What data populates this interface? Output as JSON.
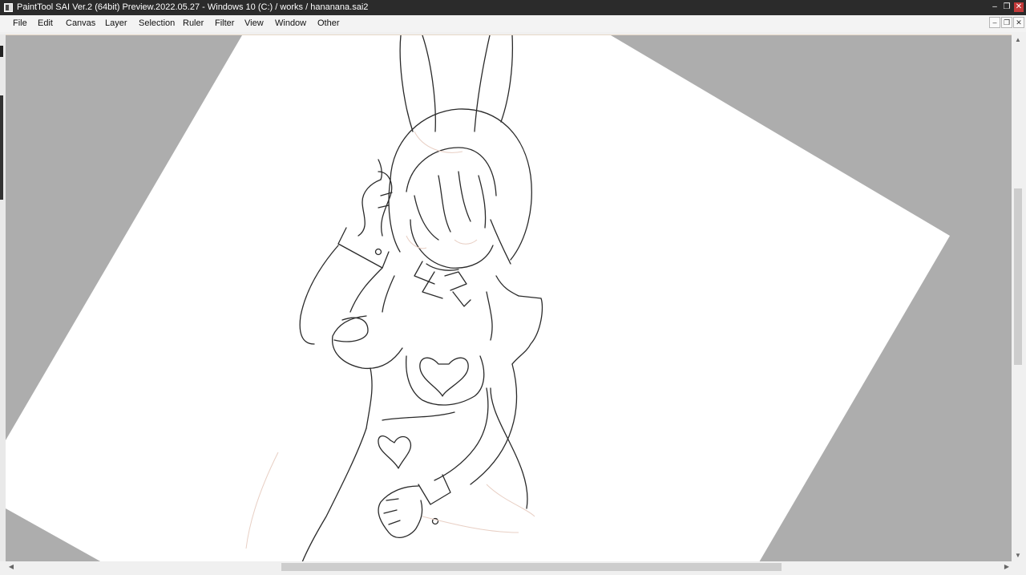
{
  "window": {
    "title": "PaintTool SAI Ver.2 (64bit) Preview.2022.05.27 - Windows 10 (C:) / works / hananana.sai2",
    "app_icon": "app-icon",
    "controls": {
      "minimize": "–",
      "restore": "❐",
      "close": "✕"
    }
  },
  "menu": {
    "items": [
      "File",
      "Edit",
      "Canvas",
      "Layer",
      "Selection",
      "Ruler",
      "Filter",
      "View",
      "Window",
      "Other"
    ]
  },
  "document_controls": {
    "minimize": "–",
    "restore": "❐",
    "close": "✕"
  },
  "canvas": {
    "background_color": "#adadad",
    "paper_color": "#ffffff",
    "line_color": "#2a2a2a",
    "artwork": "line sketch"
  },
  "scrollbars": {
    "vertical_thumb": "#cdcdcd",
    "horizontal_thumb": "#cdcdcd"
  }
}
